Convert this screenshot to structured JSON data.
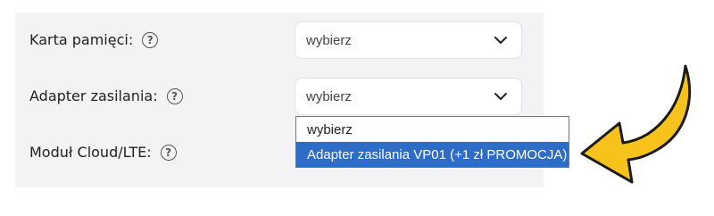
{
  "rows": [
    {
      "label": "Karta pamięci:",
      "value": "wybierz"
    },
    {
      "label": "Adapter zasilania:",
      "value": "wybierz"
    },
    {
      "label": "Moduł Cloud/LTE:"
    }
  ],
  "help_symbol": "?",
  "dropdown": {
    "options": [
      "wybierz",
      "Adapter zasilania VP01 (+1 zł PROMOCJA)"
    ],
    "highlighted_index": 1
  },
  "colors": {
    "panel": "#f3f3f5",
    "highlight": "#2d6cc7",
    "arrow_fill": "#f7c21c",
    "arrow_stroke": "#1a1a1a"
  },
  "icons": [
    "help-icon",
    "chevron-down-icon",
    "pointer-arrow"
  ]
}
